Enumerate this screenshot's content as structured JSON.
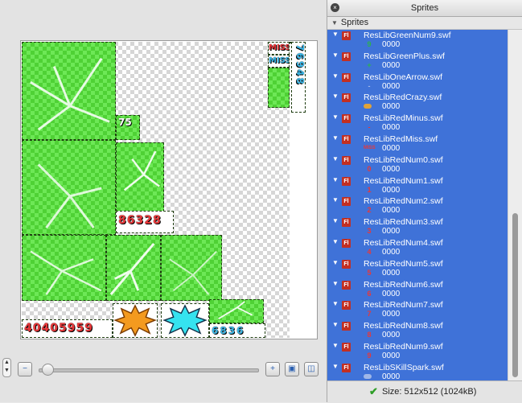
{
  "panel": {
    "title": "Sprites",
    "section_label": "Sprites"
  },
  "sprites": [
    {
      "name": "ResLibGreenNum9.swf",
      "frame": "0000",
      "thumb": "9",
      "thumb_color": "#2bb24c"
    },
    {
      "name": "ResLibGreenPlus.swf",
      "frame": "0000",
      "thumb": "+",
      "thumb_color": "#2bb24c"
    },
    {
      "name": "ResLibOneArrow.swf",
      "frame": "0000",
      "thumb": "-",
      "thumb_color": "#9fb7e8"
    },
    {
      "name": "ResLibRedCrazy.swf",
      "frame": "0000",
      "thumb": "",
      "thumb_color": "#e0a23a"
    },
    {
      "name": "ResLibRedMinus.swf",
      "frame": "0000",
      "thumb": "-",
      "thumb_color": "#e8383a"
    },
    {
      "name": "ResLibRedMiss.swf",
      "frame": "0000",
      "thumb": "MISS",
      "thumb_color": "#e8383a"
    },
    {
      "name": "ResLibRedNum0.swf",
      "frame": "0000",
      "thumb": "0",
      "thumb_color": "#e8383a"
    },
    {
      "name": "ResLibRedNum1.swf",
      "frame": "0000",
      "thumb": "1",
      "thumb_color": "#e8383a"
    },
    {
      "name": "ResLibRedNum2.swf",
      "frame": "0000",
      "thumb": "2",
      "thumb_color": "#e8383a"
    },
    {
      "name": "ResLibRedNum3.swf",
      "frame": "0000",
      "thumb": "3",
      "thumb_color": "#e8383a"
    },
    {
      "name": "ResLibRedNum4.swf",
      "frame": "0000",
      "thumb": "4",
      "thumb_color": "#e8383a"
    },
    {
      "name": "ResLibRedNum5.swf",
      "frame": "0000",
      "thumb": "5",
      "thumb_color": "#e8383a"
    },
    {
      "name": "ResLibRedNum6.swf",
      "frame": "0000",
      "thumb": "6",
      "thumb_color": "#e8383a"
    },
    {
      "name": "ResLibRedNum7.swf",
      "frame": "0000",
      "thumb": "7",
      "thumb_color": "#e8383a"
    },
    {
      "name": "ResLibRedNum8.swf",
      "frame": "0000",
      "thumb": "8",
      "thumb_color": "#e8383a"
    },
    {
      "name": "ResLibRedNum9.swf",
      "frame": "0000",
      "thumb": "9",
      "thumb_color": "#e8383a"
    },
    {
      "name": "ResLibSKillSpark.swf",
      "frame": "0000",
      "thumb": "",
      "thumb_color": "#9fb7e8"
    }
  ],
  "atlas": {
    "numbers_row": "40405959",
    "red_digits": "86328",
    "miss_labels": [
      "MISS",
      "MISS"
    ],
    "vertical_digits": "76948",
    "small_digits": "75",
    "blue_digits": "6836"
  },
  "status": {
    "size_text": "Size: 512x512 (1024kB)"
  },
  "icons": {
    "fl_badge": "Fl",
    "expand": "disclosure-triangle",
    "check": "checkmark-icon",
    "zoom_out": "zoom-out-icon",
    "zoom_in": "zoom-in-icon",
    "zoom_fit": "zoom-fit-icon",
    "zoom_actual": "zoom-actual-icon"
  },
  "colors": {
    "selection": "#3f72d8",
    "tile_green": "#4fd135",
    "flash_badge": "#c22f22"
  }
}
